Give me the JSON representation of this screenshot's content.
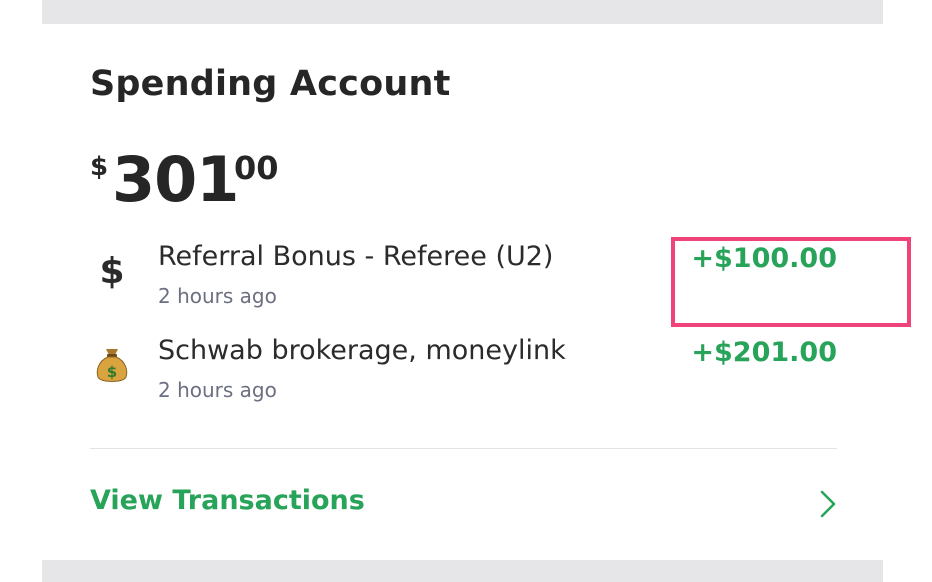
{
  "account": {
    "title": "Spending Account",
    "balance": {
      "currency_symbol": "$",
      "whole": "301",
      "cents": "00"
    }
  },
  "transactions": [
    {
      "icon": "dollar-sign-icon",
      "name": "Referral Bonus - Referee (U2)",
      "time": "2 hours ago",
      "amount": "+$100.00"
    },
    {
      "icon": "money-bag-icon",
      "name": "Schwab brokerage, moneylink",
      "time": "2 hours ago",
      "amount": "+$201.00"
    }
  ],
  "actions": {
    "view_transactions": "View Transactions"
  },
  "colors": {
    "accent_green": "#27a35a",
    "highlight": "#f0437a",
    "text_primary": "#262626",
    "text_secondary": "#6c6f80"
  }
}
